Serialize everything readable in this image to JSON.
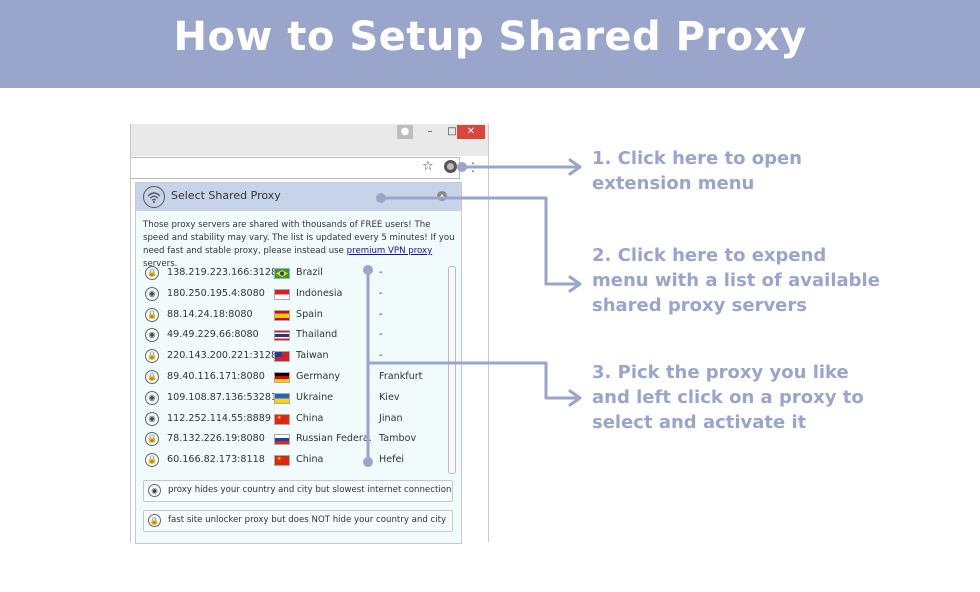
{
  "banner": {
    "title": "How to Setup Shared Proxy"
  },
  "browser": {
    "titlebar": {
      "minimize": "–",
      "maximize": "□",
      "close": "✕"
    },
    "toolbar": {
      "star": "☆",
      "menu": "⋮"
    }
  },
  "popup": {
    "title": "Select Shared Proxy",
    "description_1": "Those proxy servers are shared with thousands of FREE users! The speed and stability may vary. The list is updated every 5 minutes! If you need fast and stable proxy, please instead use ",
    "description_link": "premium VPN proxy",
    "description_2": " servers.",
    "proxies": [
      {
        "ip": "138.219.223.166:3128",
        "country": "Brazil",
        "city": "-",
        "type": "lock",
        "flag": "brazil"
      },
      {
        "ip": "180.250.195.4:8080",
        "country": "Indonesia",
        "city": "-",
        "type": "eye",
        "flag": "indonesia"
      },
      {
        "ip": "88.14.24.18:8080",
        "country": "Spain",
        "city": "-",
        "type": "lock",
        "flag": "spain"
      },
      {
        "ip": "49.49.229.66:8080",
        "country": "Thailand",
        "city": "-",
        "type": "eye",
        "flag": "thailand"
      },
      {
        "ip": "220.143.200.221:3128",
        "country": "Taiwan",
        "city": "-",
        "type": "lock",
        "flag": "taiwan"
      },
      {
        "ip": "89.40.116.171:8080",
        "country": "Germany",
        "city": "Frankfurt",
        "type": "lock",
        "flag": "germany"
      },
      {
        "ip": "109.108.87.136:53281",
        "country": "Ukraine",
        "city": "Kiev",
        "type": "eye",
        "flag": "ukraine"
      },
      {
        "ip": "112.252.114.55:8889",
        "country": "China",
        "city": "Jinan",
        "type": "eye",
        "flag": "china"
      },
      {
        "ip": "78.132.226.19:8080",
        "country": "Russian Federa...",
        "city": "Tambov",
        "type": "lock",
        "flag": "russia"
      },
      {
        "ip": "60.166.82.173:8118",
        "country": "China",
        "city": "Hefei",
        "type": "lock",
        "flag": "china"
      }
    ],
    "legend": {
      "eye_text": "proxy hides your country and city but slowest internet connection",
      "lock_text": "fast site unlocker proxy but does NOT hide your country and city"
    }
  },
  "annotations": {
    "step1_line1": "1. Click here to open",
    "step1_line2": "extension menu",
    "step2_line1": "2. Click here to expend",
    "step2_line2": "menu with a list of available",
    "step2_line3": "shared proxy servers",
    "step3_line1": "3. Pick the proxy you like",
    "step3_line2": "and left click on a proxy to",
    "step3_line3": "select and activate it"
  },
  "colors": {
    "banner": "#9aa5cc",
    "annotation": "#9aa5cc",
    "popup_header": "#c6d3e8",
    "popup_bg": "#f2fbfc",
    "close_button": "#d9463c"
  }
}
